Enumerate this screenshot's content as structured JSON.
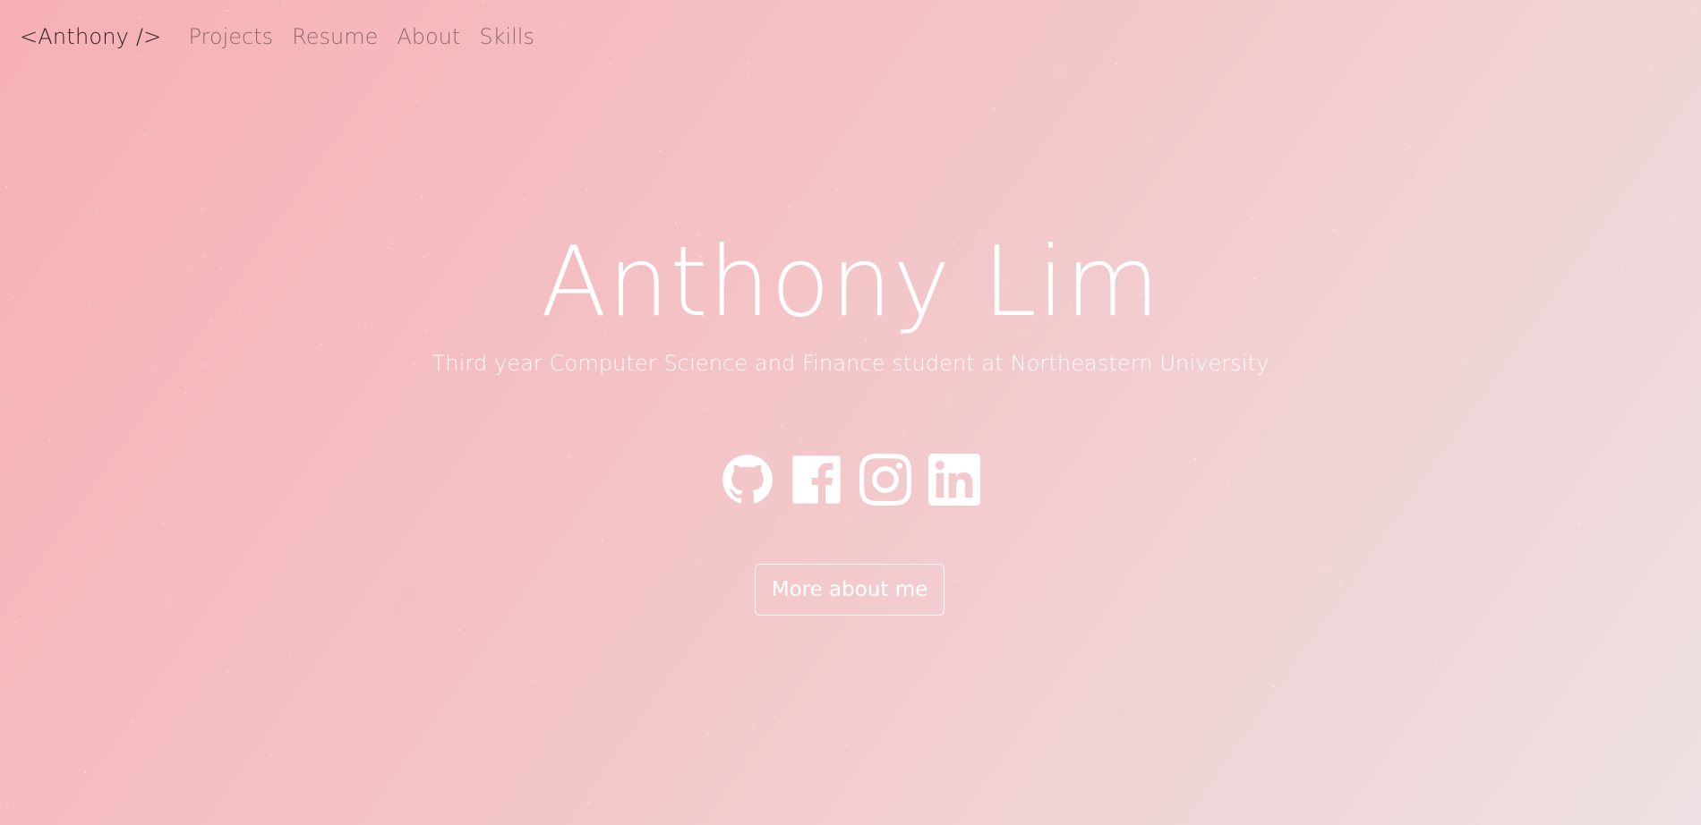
{
  "nav": {
    "brand": "<Anthony />",
    "links": [
      {
        "label": "Projects"
      },
      {
        "label": "Resume"
      },
      {
        "label": "About"
      },
      {
        "label": "Skills"
      }
    ]
  },
  "hero": {
    "title": "Anthony Lim",
    "subtitle": "Third year Computer Science and Finance student at Northeastern University",
    "socials": [
      {
        "icon": "github-icon"
      },
      {
        "icon": "facebook-icon"
      },
      {
        "icon": "instagram-icon"
      },
      {
        "icon": "linkedin-icon"
      }
    ],
    "cta_label": "More about me"
  },
  "colors": {
    "gradient_start": "#f7b0b4",
    "gradient_end": "#eee0e2",
    "hero_text": "#ffffff",
    "brand_text": "#2b1e20"
  }
}
